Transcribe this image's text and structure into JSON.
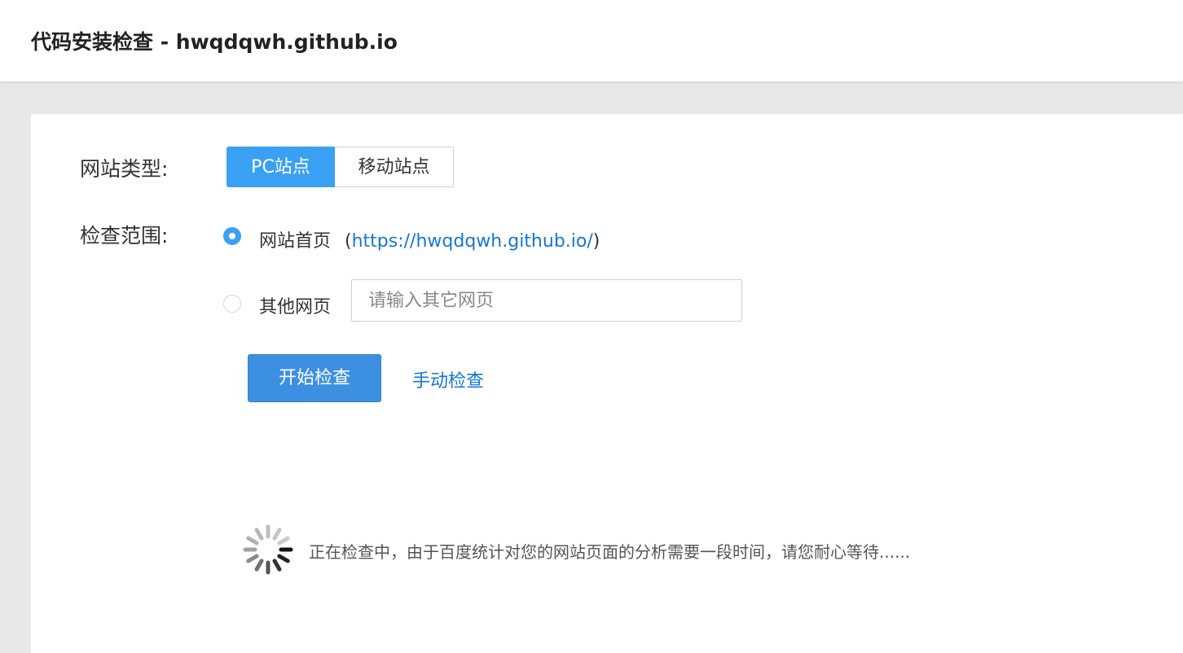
{
  "header": {
    "title": "代码安装检查 - hwqdqwh.github.io"
  },
  "form": {
    "site_type": {
      "label": "网站类型:",
      "options": [
        "PC站点",
        "移动站点"
      ],
      "selected": "PC站点"
    },
    "scope": {
      "label": "检查范围:",
      "homepage": {
        "label": "网站首页",
        "open_paren": "(",
        "url": "https://hwqdqwh.github.io/",
        "close_paren": ")",
        "checked": true
      },
      "other": {
        "label": "其他网页",
        "placeholder": "请输入其它网页",
        "value": "",
        "checked": false
      }
    },
    "start_button": "开始检查",
    "manual_link": "手动检查"
  },
  "status": {
    "message": "正在检查中，由于百度统计对您的网站页面的分析需要一段时间，请您耐心等待......",
    "icon": "loading-spinner-icon"
  },
  "colors": {
    "accent": "#3aa0f3",
    "button": "#3d8fe2",
    "link": "#1677d2",
    "page_bg": "#e8e8e8"
  }
}
